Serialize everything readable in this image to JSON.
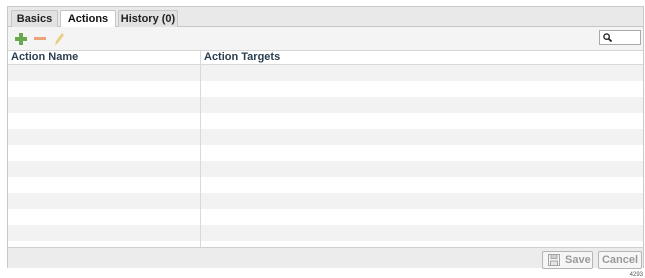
{
  "tabs": [
    {
      "label": "Basics",
      "active": false
    },
    {
      "label": "Actions",
      "active": true
    },
    {
      "label": "History (0)",
      "active": false
    }
  ],
  "toolbar": {
    "add_icon": "plus-icon",
    "remove_icon": "minus-icon",
    "edit_icon": "pencil-icon",
    "search_icon": "magnifier-icon",
    "search_value": ""
  },
  "grid": {
    "columns": [
      "Action Name",
      "Action Targets"
    ],
    "rows": []
  },
  "footer": {
    "save_label": "Save",
    "cancel_label": "Cancel"
  },
  "corner_label": "4293",
  "colors": {
    "add": "#6aa84f",
    "remove": "#e08a5e",
    "edit": "#e0c36a",
    "header_text": "#2c3e50",
    "row_alt": "#f2f2f2"
  }
}
